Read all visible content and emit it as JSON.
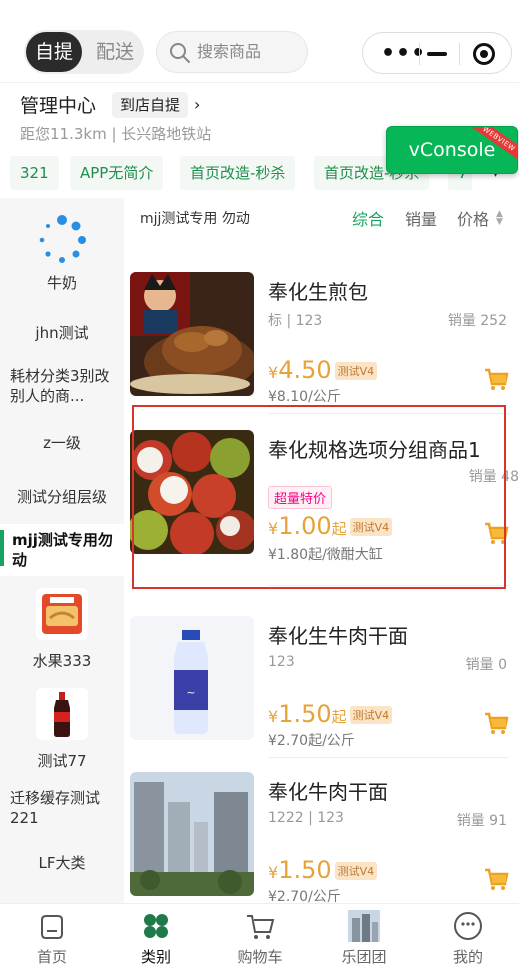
{
  "header": {
    "mode_active": "自提",
    "mode_inactive": "配送",
    "search_placeholder": "搜索商品"
  },
  "store": {
    "name": "管理中心",
    "pickup_tag": "到店自提",
    "chevron": "›",
    "distance": "距您11.3km | 长兴路地铁站"
  },
  "vconsole": {
    "label": "vConsole",
    "ribbon": "WEBVIEW"
  },
  "tags": [
    "321",
    "APP无简介",
    "首页改造-秒杀",
    "首页改造-秒杀",
    "7"
  ],
  "sidebar": {
    "items": [
      {
        "label": "牛奶",
        "icon": "spinner-icon"
      },
      {
        "label": "jhn测试"
      },
      {
        "label": "耗材分类3别改别人的商..."
      },
      {
        "label": "z一级"
      },
      {
        "label": "测试分组层级"
      },
      {
        "label": "mjj测试专用勿动",
        "active": true
      },
      {
        "label": "水果333",
        "icon": "noodle-pack"
      },
      {
        "label": "测试77",
        "icon": "cola-bottle"
      },
      {
        "label": "迁移缓存测试221"
      },
      {
        "label": "LF大类"
      }
    ]
  },
  "list_header": {
    "category": "mjj测试专用 勿动",
    "sort_default": "综合",
    "sort_sales": "销量",
    "sort_price": "价格"
  },
  "products": [
    {
      "title": "奉化生煎包",
      "spec": "标 | 123",
      "sales": "销量 252",
      "price_symbol": "¥",
      "price": "4.50",
      "price_suffix": "",
      "tag": "测试V4",
      "unit_price": "¥8.10/公斤"
    },
    {
      "title": "奉化规格选项分组商品1",
      "spec": "",
      "sales": "销量 48",
      "badge": "超量特价",
      "price_symbol": "¥",
      "price": "1.00",
      "price_suffix": "起",
      "tag": "测试V4",
      "unit_price": "¥1.80起/微酣大缸"
    },
    {
      "title": "奉化生牛肉干面",
      "spec": "123",
      "sales": "销量 0",
      "price_symbol": "¥",
      "price": "1.50",
      "price_suffix": "起",
      "tag": "测试V4",
      "unit_price": "¥2.70起/公斤"
    },
    {
      "title": "奉化牛肉干面",
      "spec": "1222 | 123",
      "sales": "销量 91",
      "price_symbol": "¥",
      "price": "1.50",
      "price_suffix": "",
      "tag": "测试V4",
      "unit_price": "¥2.70/公斤"
    }
  ],
  "tabbar": {
    "items": [
      {
        "label": "首页",
        "icon": "home-icon"
      },
      {
        "label": "类别",
        "icon": "category-icon",
        "active": true
      },
      {
        "label": "购物车",
        "icon": "cart-icon"
      },
      {
        "label": "乐团团",
        "icon": "building-photo"
      },
      {
        "label": "我的",
        "icon": "profile-icon"
      }
    ]
  },
  "colors": {
    "brand_green": "#1aa260",
    "price_orange": "#e6a33a",
    "highlight_red": "#d9342b"
  }
}
